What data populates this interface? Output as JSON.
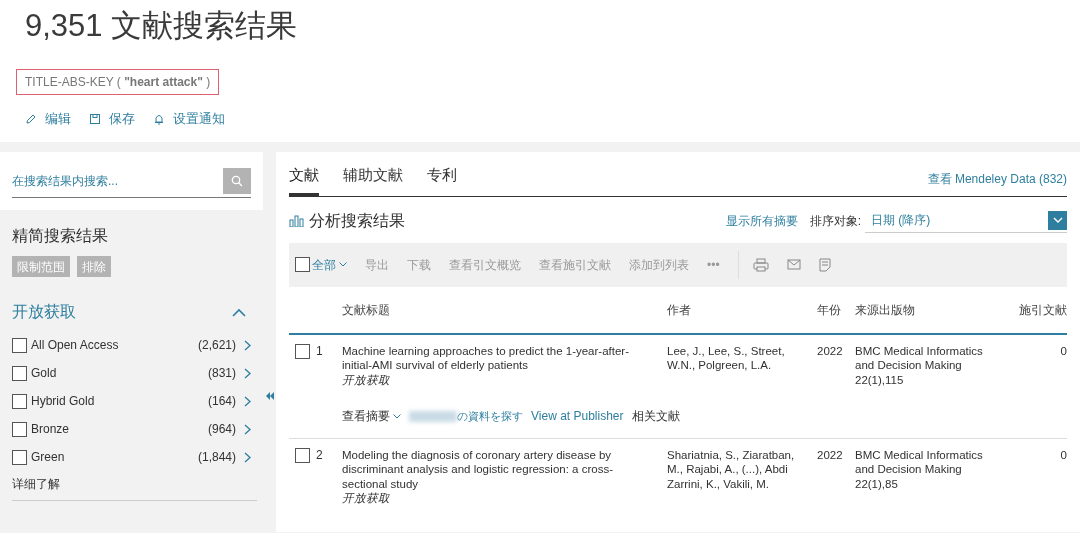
{
  "header": {
    "title": "9,351 文献搜索结果",
    "query": "TITLE-ABS-KEY ( **\"heart attack\"** )",
    "actions": [
      {
        "kind": "edit",
        "label": "编辑"
      },
      {
        "kind": "save",
        "label": "保存"
      },
      {
        "kind": "alert",
        "label": "设置通知"
      }
    ]
  },
  "sidebar": {
    "search": {
      "placeholder": "在搜索结果内搜索..."
    },
    "refine_title": "精简搜索结果",
    "refine_buttons": [
      "限制范围",
      "排除"
    ],
    "facet": {
      "title": "开放获取",
      "expanded": true,
      "items": [
        {
          "label": "All Open Access",
          "count": "(2,621)",
          "checked": false
        },
        {
          "label": "Gold",
          "count": "(831)",
          "checked": false
        },
        {
          "label": "Hybrid Gold",
          "count": "(164)",
          "checked": false
        },
        {
          "label": "Bronze",
          "count": "(964)",
          "checked": false
        },
        {
          "label": "Green",
          "count": "(1,844)",
          "checked": false
        }
      ],
      "more": "详细了解"
    }
  },
  "tabs": [
    {
      "label": "文献",
      "selected": true
    },
    {
      "label": "辅助文献",
      "selected": false
    },
    {
      "label": "专利",
      "selected": false
    }
  ],
  "mendeley_link": "查看 Mendeley Data (832)",
  "analyze": "分析搜索结果",
  "show_abstracts": "显示所有摘要",
  "sort": {
    "label": "排序对象:",
    "value": "日期 (降序)"
  },
  "toolbar": {
    "select_all": {
      "label": "全部",
      "checked": false
    },
    "actions": [
      "导出",
      "下载",
      "查看引文概览",
      "查看施引文献",
      "添加到列表",
      "•••"
    ]
  },
  "table": {
    "columns": [
      "文献标题",
      "作者",
      "年份",
      "来源出版物",
      "施引文献"
    ],
    "rows": [
      {
        "number": "1",
        "checked": false,
        "title": "Machine learning approaches to predict the 1-year-after-initial-AMI survival of elderly patients",
        "access": "开放获取",
        "authors": "Lee, J., Lee, S., Street, W.N., Polgreen, L.A.",
        "year": "2022",
        "source": "BMC Medical Informatics and Decision Making",
        "volume": "22(1),115",
        "cited": "0",
        "links": [
          "查看摘要",
          "の資料を探す",
          "View at Publisher",
          "相关文献"
        ]
      },
      {
        "number": "2",
        "checked": false,
        "title": "Modeling the diagnosis of coronary artery disease by discriminant analysis and logistic regression: a cross-sectional study",
        "access": "开放获取",
        "authors": "Shariatnia, S., Ziaratban, M., Rajabi, A., (...), Abdi Zarrini, K., Vakili, M.",
        "year": "2022",
        "source": "BMC Medical Informatics and Decision Making",
        "volume": "22(1),85",
        "cited": "0"
      }
    ]
  }
}
